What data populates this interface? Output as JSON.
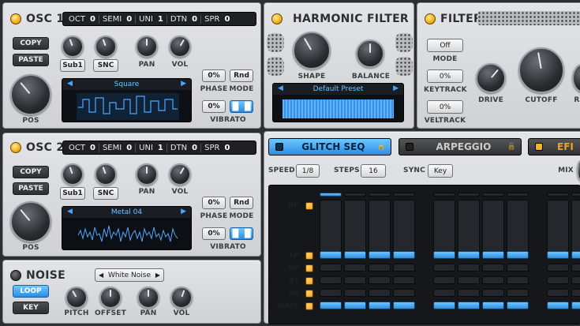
{
  "osc1": {
    "title": "OSC 1",
    "oct_label": "OCT",
    "oct": "0",
    "semi_label": "SEMI",
    "semi": "0",
    "uni_label": "UNI",
    "uni": "1",
    "dtn_label": "DTN",
    "dtn": "0",
    "spr_label": "SPR",
    "spr": "0",
    "copy": "COPY",
    "paste": "PASTE",
    "sub": "Sub1",
    "snc": "SNC",
    "pan": "PAN",
    "vol": "VOL",
    "pos": "POS",
    "wave": "Square",
    "phase_val": "0%",
    "rnd": "Rnd",
    "phase": "PHASE",
    "mode": "MODE",
    "vib_val": "0%",
    "vibrato": "VIBRATO"
  },
  "osc2": {
    "title": "OSC 2",
    "oct_label": "OCT",
    "oct": "0",
    "semi_label": "SEMI",
    "semi": "0",
    "uni_label": "UNI",
    "uni": "1",
    "dtn_label": "DTN",
    "dtn": "0",
    "spr_label": "SPR",
    "spr": "0",
    "copy": "COPY",
    "paste": "PASTE",
    "sub": "Sub1",
    "snc": "SNC",
    "pan": "PAN",
    "vol": "VOL",
    "pos": "POS",
    "wave": "Metal 04",
    "phase_val": "0%",
    "rnd": "Rnd",
    "phase": "PHASE",
    "mode": "MODE",
    "vib_val": "0%",
    "vibrato": "VIBRATO"
  },
  "noise": {
    "title": "NOISE",
    "loop": "LOOP",
    "key": "KEY",
    "type": "White Noise",
    "pitch": "PITCH",
    "offset": "OFFSET",
    "pan": "PAN",
    "vol": "VOL"
  },
  "harmonic": {
    "title": "HARMONIC FILTER",
    "shape": "SHAPE",
    "balance": "BALANCE",
    "preset": "Default Preset"
  },
  "filter": {
    "title": "FILTER",
    "mode_val": "Off",
    "mode": "MODE",
    "keytrack_val": "0%",
    "keytrack": "KEYTRACK",
    "veltrack_val": "0%",
    "veltrack": "VELTRACK",
    "drive": "DRIVE",
    "cutoff": "CUTOFF",
    "r": "R"
  },
  "seq": {
    "tab1": "GLITCH SEQ",
    "tab2": "ARPEGGIO",
    "tab3": "EFI",
    "speed_label": "SPEED",
    "speed": "1/8",
    "steps_label": "STEPS",
    "steps": "16",
    "sync_label": "SYNC",
    "sync": "Key",
    "mix": "MIX",
    "rows": [
      "RP",
      "LP",
      "HP",
      "BT",
      "SR",
      "GATE"
    ]
  },
  "colors": {
    "accent": "#2d8ee4",
    "led": "#f5b41c"
  }
}
